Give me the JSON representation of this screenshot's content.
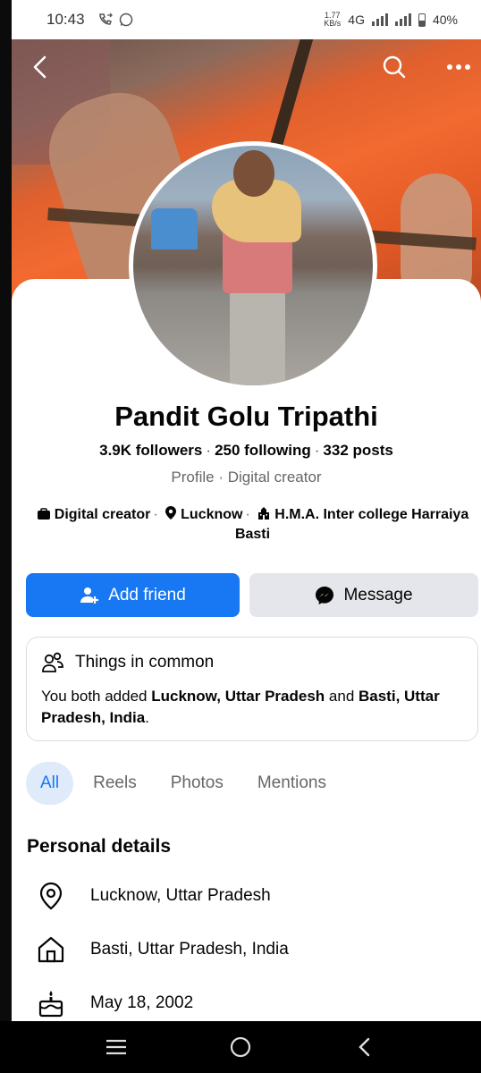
{
  "status_bar": {
    "time": "10:43",
    "net_speed_value": "1.77",
    "net_speed_unit": "KB/s",
    "network": "4G",
    "battery": "40%"
  },
  "profile": {
    "name": "Pandit Golu Tripathi",
    "followers": "3.9K followers",
    "following": "250 following",
    "posts": "332 posts",
    "subtitle": "Profile · Digital creator",
    "details": {
      "category": "Digital creator",
      "location": "Lucknow",
      "education": "H.M.A. Inter college Harraiya Basti"
    }
  },
  "actions": {
    "add_friend": "Add friend",
    "message": "Message"
  },
  "common": {
    "title": "Things in common",
    "prefix": "You both added ",
    "place1": "Lucknow, Uttar Pradesh",
    "conj": " and ",
    "place2": "Basti, Uttar Pradesh, India",
    "suffix": "."
  },
  "tabs": [
    "All",
    "Reels",
    "Photos",
    "Mentions"
  ],
  "personal": {
    "title": "Personal details",
    "current_city": "Lucknow, Uttar Pradesh",
    "hometown": "Basti, Uttar Pradesh, India",
    "birthday": "May 18, 2002"
  },
  "colors": {
    "accent": "#1877f2",
    "secondary_button": "#e4e6eb",
    "muted_text": "#65676b"
  }
}
